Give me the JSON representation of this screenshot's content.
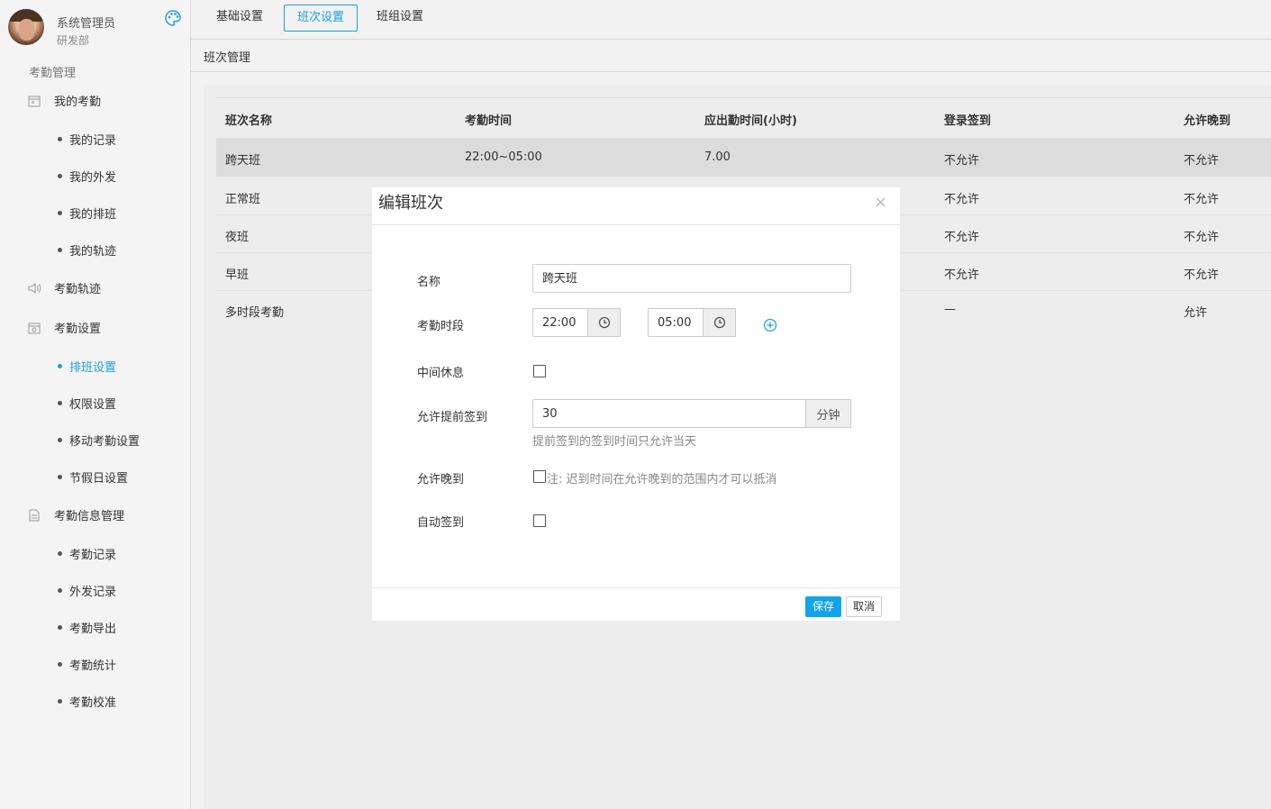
{
  "user": {
    "name": "系统管理员",
    "dept": "研发部"
  },
  "sidebar": {
    "section_title": "考勤管理",
    "groups": [
      {
        "label": "我的考勤",
        "icon": "calendar-icon"
      },
      {
        "label": "考勤轨迹",
        "icon": "speaker-icon"
      },
      {
        "label": "考勤设置",
        "icon": "calendar-settings-icon"
      },
      {
        "label": "考勤信息管理",
        "icon": "document-icon"
      }
    ],
    "my_attendance_items": [
      "我的记录",
      "我的外发",
      "我的排班",
      "我的轨迹"
    ],
    "settings_items": [
      "排班设置",
      "权限设置",
      "移动考勤设置",
      "节假日设置"
    ],
    "info_items": [
      "考勤记录",
      "外发记录",
      "考勤导出",
      "考勤统计",
      "考勤校准"
    ],
    "active_item": "排班设置"
  },
  "tabs": [
    "基础设置",
    "班次设置",
    "班组设置"
  ],
  "active_tab": "班次设置",
  "breadcrumb": "班次管理",
  "table": {
    "headers": [
      "班次名称",
      "考勤时间",
      "应出勤时间(小时)",
      "登录签到",
      "允许晚到"
    ],
    "rows": [
      [
        "跨天班",
        "22:00~05:00",
        "7.00",
        "不允许",
        "不允许"
      ],
      [
        "正常班",
        "",
        "",
        "不允许",
        "不允许"
      ],
      [
        "夜班",
        "",
        "",
        "不允许",
        "不允许"
      ],
      [
        "早班",
        "",
        "",
        "不允许",
        "不允许"
      ],
      [
        "多时段考勤",
        "",
        "",
        "—",
        "允许"
      ]
    ]
  },
  "modal": {
    "title": "编辑班次",
    "close": "×",
    "name_label": "名称",
    "name_value": "跨天班",
    "period_label": "考勤时段",
    "start_time": "22:00",
    "end_time": "05:00",
    "break_label": "中间休息",
    "early_label": "允许提前签到",
    "early_value": "30",
    "early_unit": "分钟",
    "early_hint": "提前签到的签到时间只允许当天",
    "late_label": "允许晚到",
    "late_hint": "注: 迟到时间在允许晚到的范围内才可以抵消",
    "auto_label": "自动签到",
    "save": "保存",
    "cancel": "取消"
  },
  "colors": {
    "accent": "#1e9fda",
    "save_button": "#12a4e6",
    "selected_row": "#dcdcdc"
  }
}
